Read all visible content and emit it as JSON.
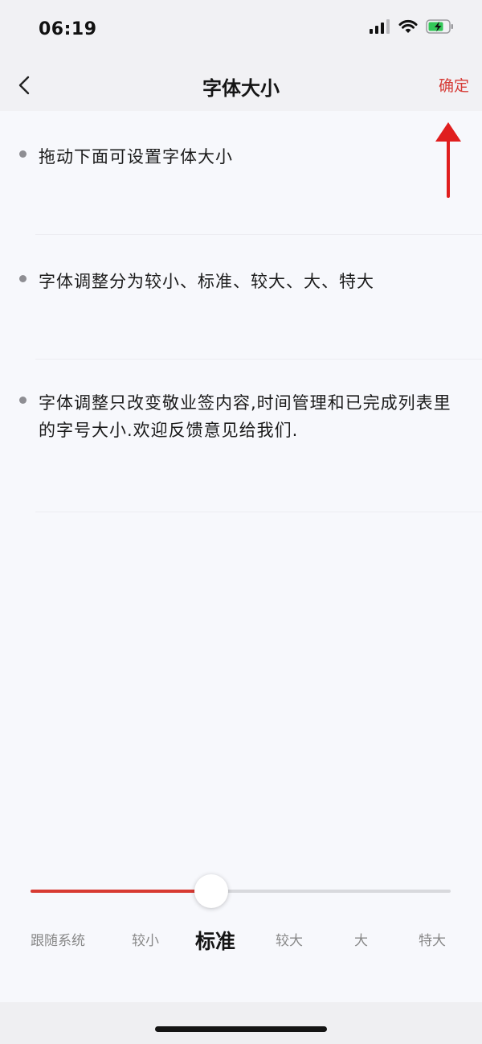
{
  "status_bar": {
    "time": "06:19"
  },
  "nav": {
    "title": "字体大小",
    "confirm_label": "确定"
  },
  "tips": [
    "拖动下面可设置字体大小",
    "字体调整分为较小、标准、较大、大、特大",
    "字体调整只改变敬业签内容,时间管理和已完成列表里的字号大小.欢迎反馈意见给我们."
  ],
  "slider": {
    "options": [
      "跟随系统",
      "较小",
      "标准",
      "较大",
      "大",
      "特大"
    ],
    "selected": "标准"
  },
  "colors": {
    "accent": "#d63a35",
    "background": "#f7f8fc",
    "nav_background": "#f1f1f4"
  }
}
